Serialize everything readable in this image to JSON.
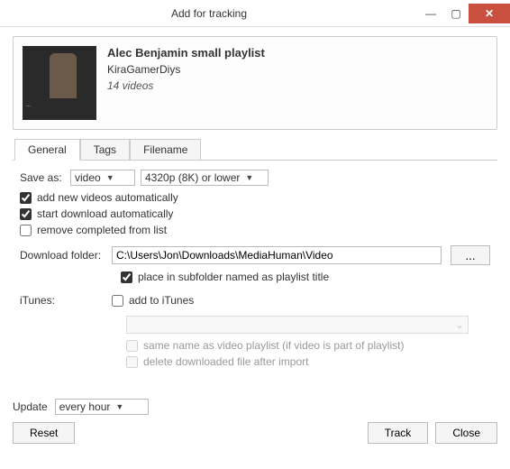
{
  "window": {
    "title": "Add for tracking"
  },
  "playlist": {
    "title": "Alec Benjamin small playlist",
    "author": "KiraGamerDiys",
    "count": "14 videos"
  },
  "tabs": {
    "general": "General",
    "tags": "Tags",
    "filename": "Filename"
  },
  "general": {
    "save_as_label": "Save as:",
    "format": "video",
    "quality": "4320p (8K) or lower",
    "add_new_label": "add new videos automatically",
    "start_download_label": "start download automatically",
    "remove_completed_label": "remove completed from list",
    "download_folder_label": "Download folder:",
    "download_path": "C:\\Users\\Jon\\Downloads\\MediaHuman\\Video",
    "browse_label": "...",
    "subfolder_label": "place in subfolder named as playlist title",
    "itunes_label": "iTunes:",
    "add_to_itunes_label": "add to iTunes",
    "same_name_label": "same name as video playlist (if video is part of playlist)",
    "delete_after_label": "delete downloaded file after import"
  },
  "footer": {
    "update_label": "Update",
    "update_value": "every hour",
    "reset": "Reset",
    "track": "Track",
    "close": "Close"
  }
}
